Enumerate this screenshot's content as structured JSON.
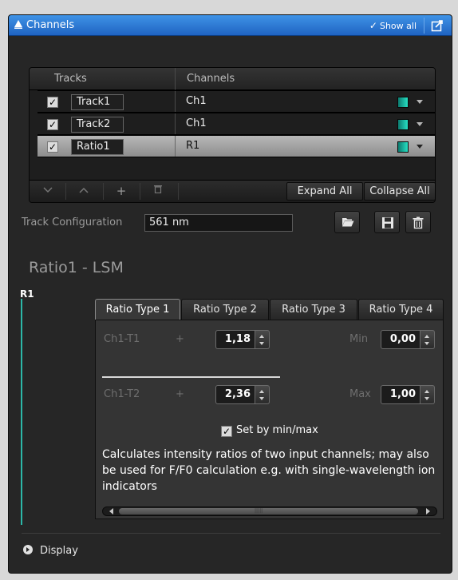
{
  "panel": {
    "title": "Channels",
    "show_all_label": "Show all",
    "check_glyph": "✓"
  },
  "tracks": {
    "headers": [
      "Tracks",
      "Channels"
    ],
    "rows": [
      {
        "checked": true,
        "track": "Track1",
        "channel": "Ch1",
        "color": "#1ec9b2"
      },
      {
        "checked": true,
        "track": "Track2",
        "channel": "Ch1",
        "color": "#1ec9b2"
      },
      {
        "checked": true,
        "track": "Ratio1",
        "channel": "R1",
        "color": "#1ec9b2",
        "selected": true
      }
    ],
    "toolbar": {
      "add_glyph": "+",
      "expand_all": "Expand All",
      "collapse_all": "Collapse All"
    }
  },
  "track_config": {
    "label": "Track Configuration",
    "value": "561 nm"
  },
  "section": {
    "title": "Ratio1 - LSM",
    "left_label": "R1"
  },
  "ratio": {
    "tabs": [
      "Ratio Type 1",
      "Ratio Type 2",
      "Ratio Type 3",
      "Ratio Type 4"
    ],
    "active_tab": "Ratio Type 1",
    "numerator_label": "Ch1-T1",
    "numerator_op": "+",
    "numerator_value": "1,18",
    "denominator_label": "Ch1-T2",
    "denominator_op": "+",
    "denominator_value": "2,36",
    "min_label": "Min",
    "min_value": "0,00",
    "max_label": "Max",
    "max_value": "1,00",
    "set_by_label": "Set by min/max",
    "set_by_checked": true,
    "description": "Calculates intensity ratios of two input channels; may also be used for F/F0 calculation e.g. with single-wavelength ion indicators"
  },
  "footer": {
    "display_label": "Display"
  },
  "colors": {
    "title_bar": "#2f7ad6",
    "accent_teal": "#2cb7a8",
    "panel_bg": "#262626"
  }
}
